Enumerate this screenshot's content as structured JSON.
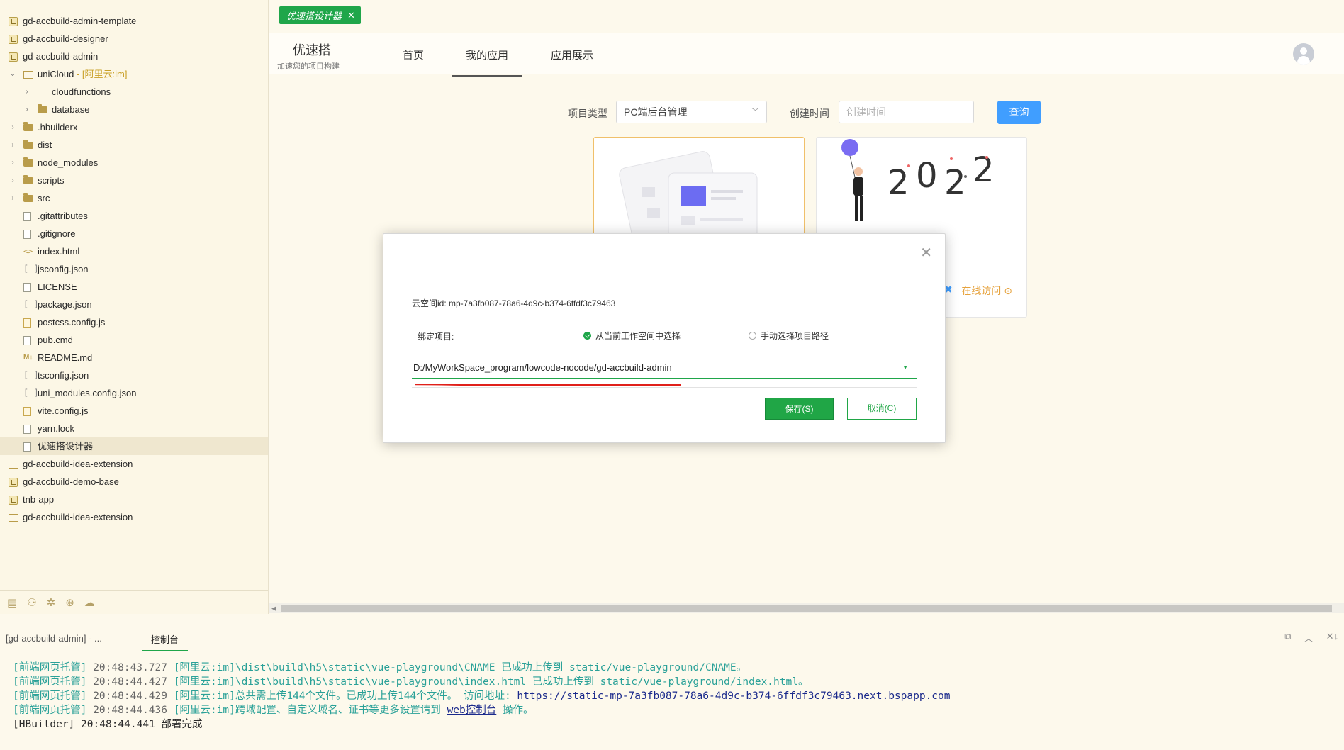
{
  "sidebar": {
    "items": [
      {
        "label": "gd-accbuild-admin-template",
        "level": 0,
        "icon": "project-icon",
        "arrow": ""
      },
      {
        "label": "gd-accbuild-designer",
        "level": 0,
        "icon": "project-icon",
        "arrow": ""
      },
      {
        "label": "gd-accbuild-admin",
        "level": 0,
        "icon": "project-icon",
        "arrow": "down"
      },
      {
        "label": "uniCloud",
        "suffix": " - [阿里云:im]",
        "level": 1,
        "icon": "folder-open-icon",
        "arrow": "down"
      },
      {
        "label": "cloudfunctions",
        "level": 2,
        "icon": "folder-open-icon",
        "arrow": "right"
      },
      {
        "label": "database",
        "level": 2,
        "icon": "folder-icon",
        "arrow": "right"
      },
      {
        "label": ".hbuilderx",
        "level": 1,
        "icon": "folder-icon",
        "arrow": "right"
      },
      {
        "label": "dist",
        "level": 1,
        "icon": "folder-icon",
        "arrow": "right"
      },
      {
        "label": "node_modules",
        "level": 1,
        "icon": "folder-icon",
        "arrow": "right"
      },
      {
        "label": "scripts",
        "level": 1,
        "icon": "folder-icon",
        "arrow": "right"
      },
      {
        "label": "src",
        "level": 1,
        "icon": "folder-icon",
        "arrow": "right"
      },
      {
        "label": ".gitattributes",
        "level": 1,
        "icon": "file-icon",
        "arrow": ""
      },
      {
        "label": ".gitignore",
        "level": 1,
        "icon": "file-icon",
        "arrow": ""
      },
      {
        "label": "index.html",
        "level": 1,
        "icon": "html-icon",
        "arrow": ""
      },
      {
        "label": "jsconfig.json",
        "level": 1,
        "icon": "json-icon",
        "arrow": ""
      },
      {
        "label": "LICENSE",
        "level": 1,
        "icon": "file-icon",
        "arrow": ""
      },
      {
        "label": "package.json",
        "level": 1,
        "icon": "json-icon",
        "arrow": ""
      },
      {
        "label": "postcss.config.js",
        "level": 1,
        "icon": "js-icon",
        "arrow": ""
      },
      {
        "label": "pub.cmd",
        "level": 1,
        "icon": "file-icon",
        "arrow": ""
      },
      {
        "label": "README.md",
        "level": 1,
        "icon": "markdown-icon",
        "arrow": ""
      },
      {
        "label": "tsconfig.json",
        "level": 1,
        "icon": "json-icon",
        "arrow": ""
      },
      {
        "label": "uni_modules.config.json",
        "level": 1,
        "icon": "json-icon",
        "arrow": ""
      },
      {
        "label": "vite.config.js",
        "level": 1,
        "icon": "js-icon",
        "arrow": ""
      },
      {
        "label": "yarn.lock",
        "level": 1,
        "icon": "file-icon",
        "arrow": ""
      },
      {
        "label": "优速搭设计器",
        "level": 1,
        "icon": "file-icon",
        "arrow": "",
        "selected": true
      },
      {
        "label": "gd-accbuild-idea-extension",
        "level": 0,
        "icon": "folder-open-icon",
        "arrow": ""
      },
      {
        "label": "gd-accbuild-demo-base",
        "level": 0,
        "icon": "project-icon",
        "arrow": ""
      },
      {
        "label": "tnb-app",
        "level": 0,
        "icon": "project-icon",
        "arrow": ""
      },
      {
        "label": "gd-accbuild-idea-extension",
        "level": 0,
        "icon": "folder-open-icon",
        "arrow": ""
      }
    ]
  },
  "preview": {
    "tab_label": "优速搭设计器",
    "tab_close": "✕",
    "brand_title": "优速搭",
    "brand_sub": "加速您的项目构建",
    "nav": [
      "首页",
      "我的应用",
      "应用展示"
    ],
    "filter_type_label": "项目类型",
    "filter_type_value": "PC端后台管理",
    "filter_time_label": "创建时间",
    "filter_time_placeholder": "创建时间",
    "query_button": "查询",
    "card_link": "在线访问"
  },
  "dialog": {
    "space_id": "云空间id: mp-7a3fb087-78a6-4d9c-b374-6ffdf3c79463",
    "bind_label": "绑定项目:",
    "radio_workspace": "从当前工作空间中选择",
    "radio_manual": "手动选择项目路径",
    "path_value": "D:/MyWorkSpace_program/lowcode-nocode/gd-accbuild-admin",
    "save_button": "保存(S)",
    "cancel_button": "取消(C)",
    "close": "✕"
  },
  "console": {
    "tab_project": "[gd-accbuild-admin] - ...",
    "tab_console": "控制台",
    "lines": [
      {
        "prefix": "[前端网页托管]",
        "time": " 20:48:43.727 ",
        "msg": "[阿里云:im]\\dist\\build\\h5\\static\\vue-playground\\CNAME 已成功上传到 static/vue-playground/CNAME。"
      },
      {
        "prefix": "[前端网页托管]",
        "time": " 20:48:44.427 ",
        "msg": "[阿里云:im]\\dist\\build\\h5\\static\\vue-playground\\index.html 已成功上传到 static/vue-playground/index.html。"
      },
      {
        "prefix": "[前端网页托管]",
        "time": " 20:48:44.429 ",
        "msg": "[阿里云:im]总共需上传144个文件。已成功上传144个文件。  访问地址: ",
        "link": "https://static-mp-7a3fb087-78a6-4d9c-b374-6ffdf3c79463.next.bspapp.com"
      },
      {
        "prefix": "[前端网页托管]",
        "time": " 20:48:44.436 ",
        "msg": "[阿里云:im]跨域配置、自定义域名、证书等更多设置请到 ",
        "link": "web控制台",
        "tail": " 操作。"
      },
      {
        "prefix": "[HBuilder]",
        "time": " 20:48:44.441 ",
        "msg": "部署完成",
        "plain": true
      }
    ]
  },
  "colors": {
    "accent": "#1fa64a",
    "link": "#409eff",
    "warning": "#e6a23c",
    "console_green": "#2aa198"
  }
}
